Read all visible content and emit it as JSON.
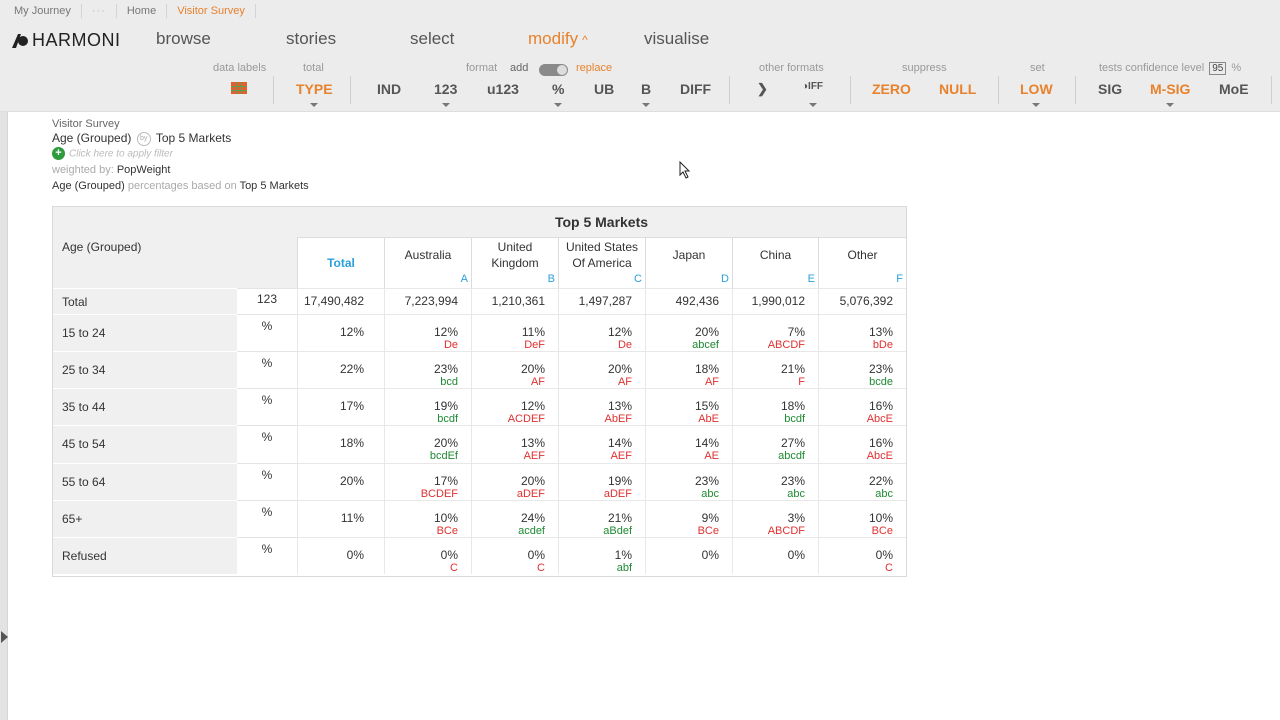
{
  "breadcrumb": [
    "My Journey",
    "···",
    "Home",
    "Visitor Survey"
  ],
  "app": {
    "name": "HARMONI"
  },
  "nav": [
    {
      "label": "browse"
    },
    {
      "label": "stories"
    },
    {
      "label": "select"
    },
    {
      "label": "modify",
      "caret": "^"
    },
    {
      "label": "visualise"
    }
  ],
  "toolbar": {
    "labels": {
      "data_labels": "data labels",
      "total": "total",
      "format": "format",
      "add": "add",
      "replace": "replace",
      "other_formats": "other formats",
      "suppress": "suppress",
      "set": "set",
      "tests": "tests confidence level",
      "confidence": "95",
      "pct": "%"
    },
    "buttons": {
      "type": "TYPE",
      "ind": "IND",
      "n123": "123",
      "u123": "u123",
      "pct": "%",
      "ub": "UB",
      "b": "B",
      "diff": "DIFF",
      "zero": "ZERO",
      "null": "NULL",
      "low": "LOW",
      "sig": "SIG",
      "msig": "M-SIG",
      "moe": "MoE"
    }
  },
  "info": {
    "survey": "Visitor Survey",
    "row_var": "Age (Grouped)",
    "by": "by",
    "col_var": "Top 5 Markets",
    "filter": "Click here to apply filter",
    "weighted_by_label": "weighted by:",
    "weight": "PopWeight",
    "pct_row": "Age (Grouped)",
    "pct_text": "percentages based on",
    "pct_col": "Top 5 Markets"
  },
  "table": {
    "row_header": "Age (Grouped)",
    "band": "Top 5 Markets",
    "columns": [
      {
        "name": "Total",
        "letter": ""
      },
      {
        "name": "Australia",
        "letter": "A"
      },
      {
        "name": "United Kingdom",
        "letter": "B"
      },
      {
        "name": "United States Of America",
        "letter": "C"
      },
      {
        "name": "Japan",
        "letter": "D"
      },
      {
        "name": "China",
        "letter": "E"
      },
      {
        "name": "Other",
        "letter": "F"
      }
    ],
    "rows": [
      {
        "label": "Total",
        "stat": "123",
        "cells": [
          {
            "v": "17,490,482"
          },
          {
            "v": "7,223,994"
          },
          {
            "v": "1,210,361"
          },
          {
            "v": "1,497,287"
          },
          {
            "v": "492,436"
          },
          {
            "v": "1,990,012"
          },
          {
            "v": "5,076,392"
          }
        ]
      },
      {
        "label": "15 to 24",
        "stat": "%",
        "cells": [
          {
            "v": "12%"
          },
          {
            "v": "12%",
            "s": "De",
            "c": "r"
          },
          {
            "v": "11%",
            "s": "DeF",
            "c": "r"
          },
          {
            "v": "12%",
            "s": "De",
            "c": "r"
          },
          {
            "v": "20%",
            "s": "abcef",
            "c": "g"
          },
          {
            "v": "7%",
            "s": "ABCDF",
            "c": "r"
          },
          {
            "v": "13%",
            "s": "bDe",
            "c": "m"
          }
        ]
      },
      {
        "label": "25 to 34",
        "stat": "%",
        "cells": [
          {
            "v": "22%"
          },
          {
            "v": "23%",
            "s": "bcd",
            "c": "g"
          },
          {
            "v": "20%",
            "s": "AF",
            "c": "r"
          },
          {
            "v": "20%",
            "s": "AF",
            "c": "r"
          },
          {
            "v": "18%",
            "s": "AF",
            "c": "r"
          },
          {
            "v": "21%",
            "s": "F",
            "c": "r"
          },
          {
            "v": "23%",
            "s": "bcde",
            "c": "g"
          }
        ]
      },
      {
        "label": "35 to 44",
        "stat": "%",
        "cells": [
          {
            "v": "17%"
          },
          {
            "v": "19%",
            "s": "bcdf",
            "c": "g"
          },
          {
            "v": "12%",
            "s": "ACDEF",
            "c": "r"
          },
          {
            "v": "13%",
            "s": "AbEF",
            "c": "r"
          },
          {
            "v": "15%",
            "s": "AbE",
            "c": "r"
          },
          {
            "v": "18%",
            "s": "bcdf",
            "c": "g"
          },
          {
            "v": "16%",
            "s": "AbcE",
            "c": "r"
          }
        ]
      },
      {
        "label": "45 to 54",
        "stat": "%",
        "cells": [
          {
            "v": "18%"
          },
          {
            "v": "20%",
            "s": "bcdEf",
            "c": "g"
          },
          {
            "v": "13%",
            "s": "AEF",
            "c": "r"
          },
          {
            "v": "14%",
            "s": "AEF",
            "c": "r"
          },
          {
            "v": "14%",
            "s": "AE",
            "c": "r"
          },
          {
            "v": "27%",
            "s": "abcdf",
            "c": "g"
          },
          {
            "v": "16%",
            "s": "AbcE",
            "c": "r"
          }
        ]
      },
      {
        "label": "55 to 64",
        "stat": "%",
        "cells": [
          {
            "v": "20%"
          },
          {
            "v": "17%",
            "s": "BCDEF",
            "c": "r"
          },
          {
            "v": "20%",
            "s": "aDEF",
            "c": "r"
          },
          {
            "v": "19%",
            "s": "aDEF",
            "c": "r"
          },
          {
            "v": "23%",
            "s": "abc",
            "c": "g"
          },
          {
            "v": "23%",
            "s": "abc",
            "c": "g"
          },
          {
            "v": "22%",
            "s": "abc",
            "c": "g"
          }
        ]
      },
      {
        "label": "65+",
        "stat": "%",
        "cells": [
          {
            "v": "11%"
          },
          {
            "v": "10%",
            "s": "BCe",
            "c": "r"
          },
          {
            "v": "24%",
            "s": "acdef",
            "c": "g"
          },
          {
            "v": "21%",
            "s": "aBdef",
            "c": "g"
          },
          {
            "v": "9%",
            "s": "BCe",
            "c": "r"
          },
          {
            "v": "3%",
            "s": "ABCDF",
            "c": "r"
          },
          {
            "v": "10%",
            "s": "BCe",
            "c": "r"
          }
        ]
      },
      {
        "label": "Refused",
        "stat": "%",
        "cells": [
          {
            "v": "0%"
          },
          {
            "v": "0%",
            "s": "C",
            "c": "r"
          },
          {
            "v": "0%",
            "s": "C",
            "c": "r"
          },
          {
            "v": "1%",
            "s": "abf",
            "c": "g"
          },
          {
            "v": "0%"
          },
          {
            "v": "0%"
          },
          {
            "v": "0%",
            "s": "C",
            "c": "r"
          }
        ]
      }
    ]
  },
  "colors": {
    "accent": "#e8822c",
    "link_blue": "#2aa0d8",
    "sig_green": "#1e8a32",
    "sig_red": "#e03030"
  }
}
